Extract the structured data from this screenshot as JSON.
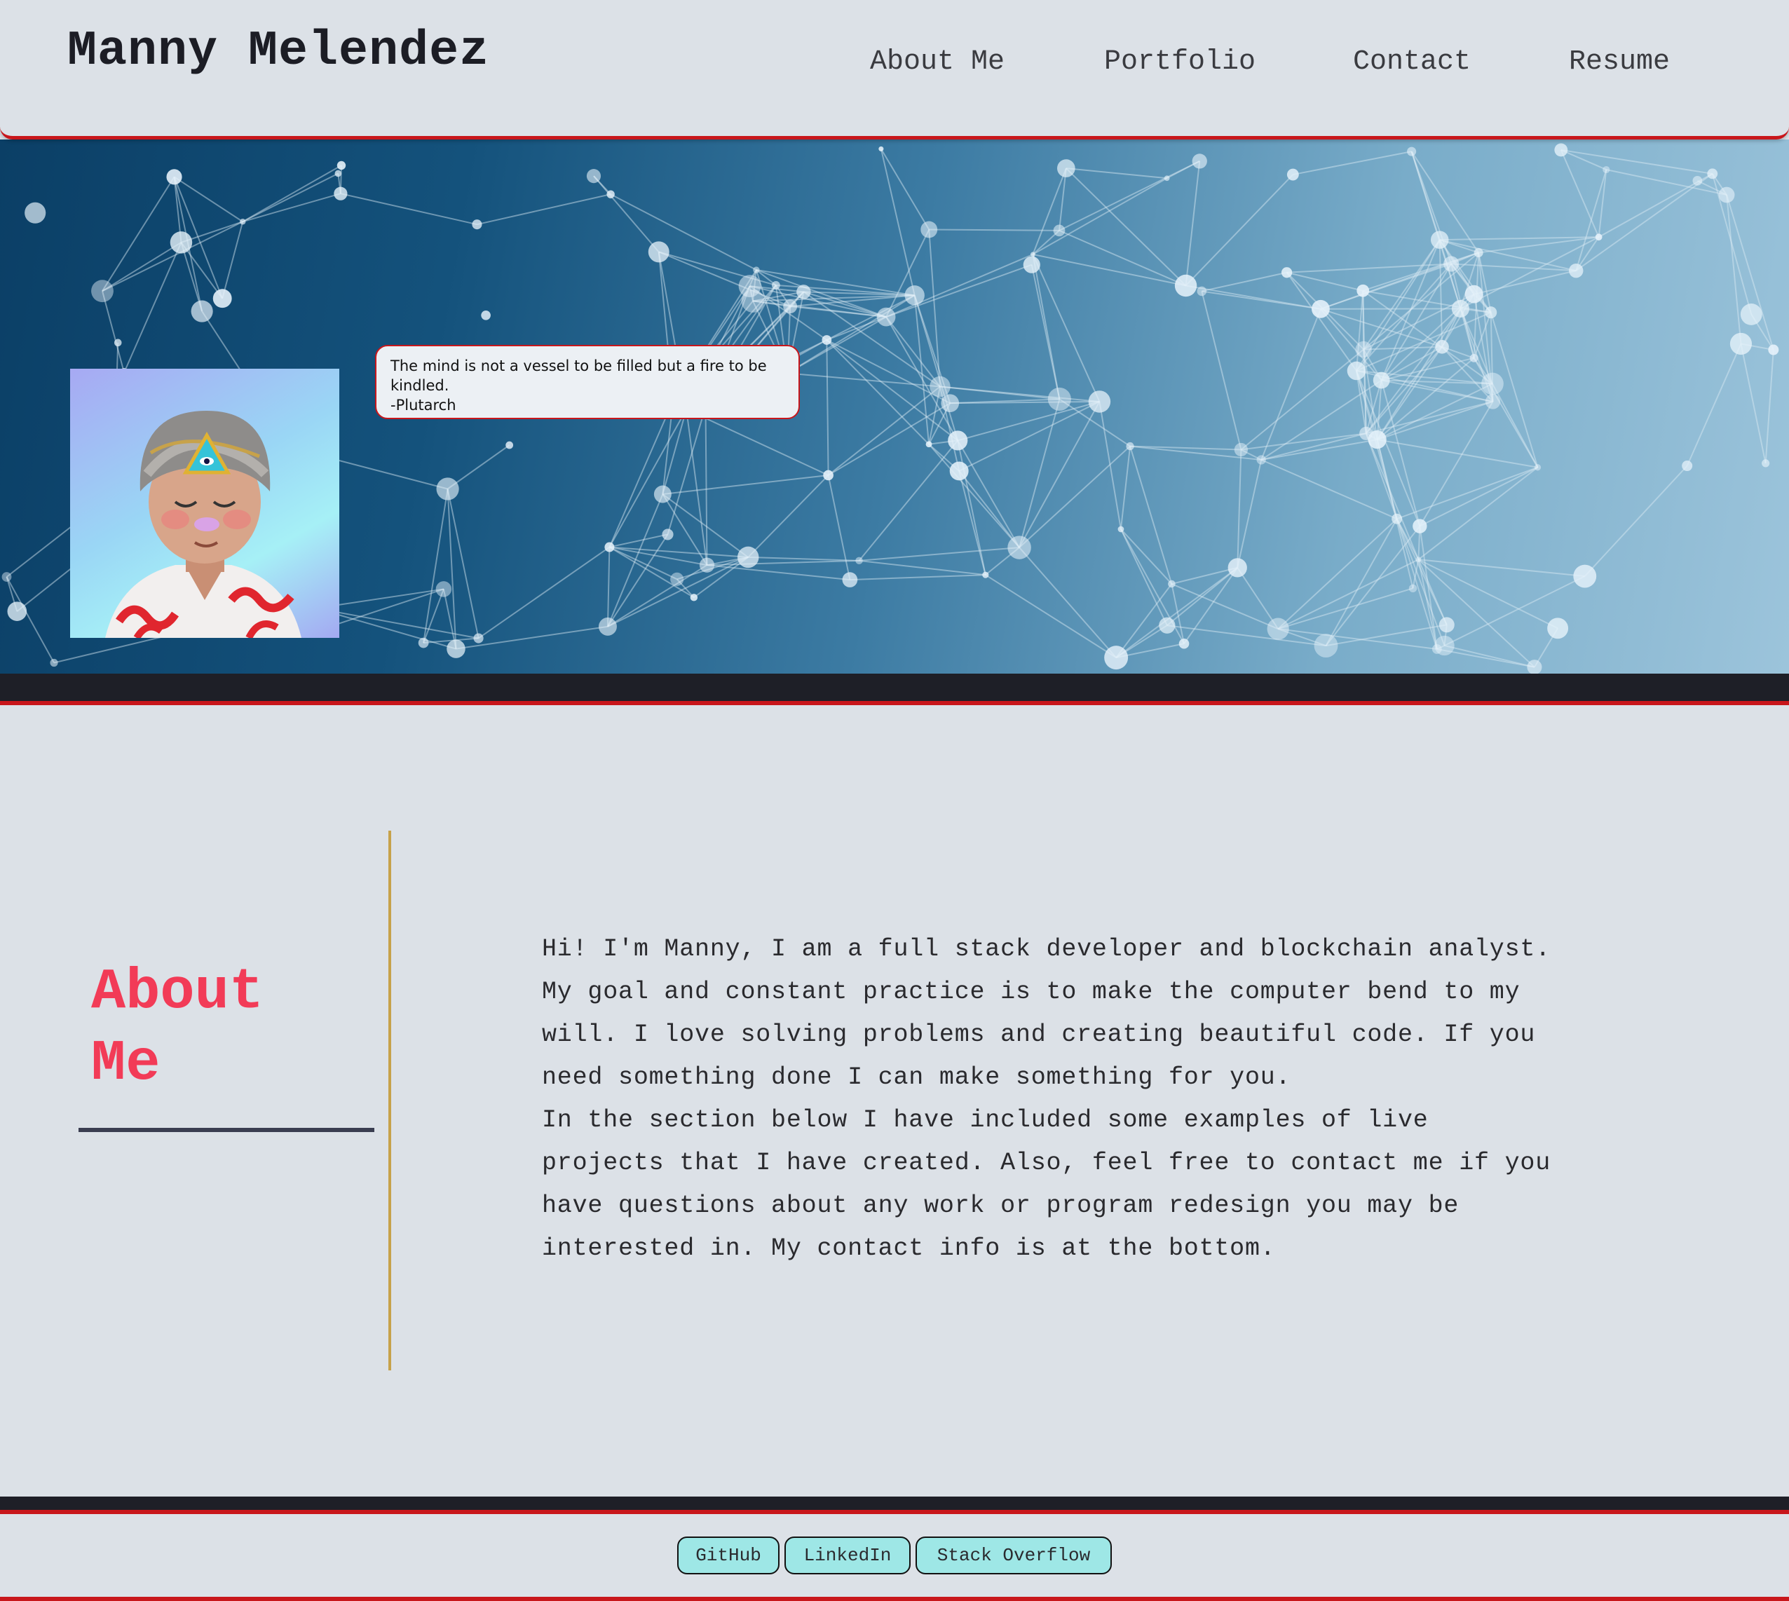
{
  "header": {
    "title": "Manny Melendez",
    "nav": [
      "About Me",
      "Portfolio",
      "Contact",
      "Resume"
    ]
  },
  "hero": {
    "quote_lines": [
      "The mind is not a vessel to be filled but a fire to be kindled.",
      "-Plutarch"
    ]
  },
  "about": {
    "heading_line1": "About",
    "heading_line2": "Me",
    "paragraph1": "Hi! I'm Manny, I am a full stack developer and blockchain analyst. My goal and constant practice is to make the computer bend to my will. I love solving problems and creating beautiful code. If you need something done I can make something for you.",
    "paragraph2": "In the section below I have included some examples of live projects that I have created. Also, feel free to contact me if you have questions about any work or program redesign you may be interested in. My contact info is at the bottom."
  },
  "footer": {
    "links": [
      "GitHub",
      "LinkedIn",
      "Stack Overflow"
    ]
  },
  "colors": {
    "accent_red": "#c8161b",
    "heading_pink": "#f23b57",
    "button_teal": "#9ee7e6",
    "divider_gold": "#c7a24a"
  }
}
